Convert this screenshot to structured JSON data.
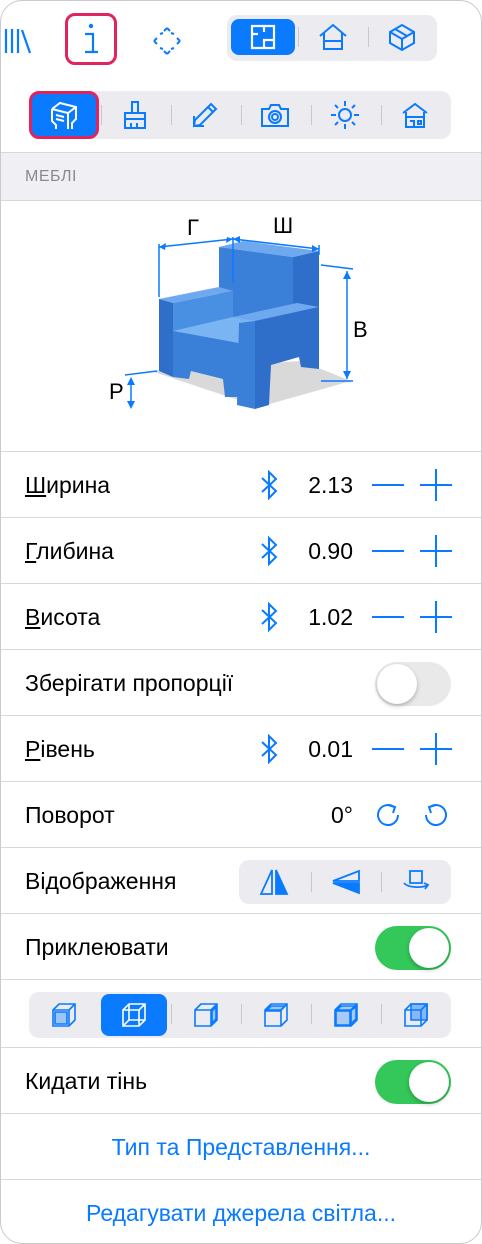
{
  "colors": {
    "accent": "#0a7aff",
    "highlight": "#e0245e",
    "toggle_on": "#34c759",
    "furniture": "#4a90e2"
  },
  "toolbar_top": {
    "buttons": [
      {
        "icon": "library-icon",
        "interactable": true
      },
      {
        "icon": "info-icon",
        "interactable": true,
        "highlighted": true
      },
      {
        "icon": "focus-icon",
        "interactable": true
      }
    ],
    "view_segment": [
      {
        "icon": "floorplan-view-icon",
        "active": true
      },
      {
        "icon": "house-view-icon",
        "active": false
      },
      {
        "icon": "3d-box-view-icon",
        "active": false
      }
    ]
  },
  "toolbar_tools": {
    "items": [
      {
        "icon": "furniture-icon",
        "active": true,
        "highlighted": true
      },
      {
        "icon": "paint-brush-icon",
        "active": false
      },
      {
        "icon": "pencil-icon",
        "active": false
      },
      {
        "icon": "camera-icon",
        "active": false
      },
      {
        "icon": "light-icon",
        "active": false
      },
      {
        "icon": "building-icon",
        "active": false
      }
    ]
  },
  "section": {
    "title": "МЕБЛІ"
  },
  "diagram": {
    "label_depth": "Г",
    "label_width": "Ш",
    "label_height": "В",
    "label_level": "Р"
  },
  "properties": {
    "width": {
      "label_first": "Ш",
      "label_rest": "ирина",
      "value": "2.13"
    },
    "depth": {
      "label_first": "Г",
      "label_rest": "либина",
      "value": "0.90"
    },
    "height": {
      "label_first": "В",
      "label_rest": "исота",
      "value": "1.02"
    },
    "keep_proportions": {
      "label": "Зберігати пропорції",
      "on": false
    },
    "level": {
      "label_first": "Р",
      "label_rest": "івень",
      "value": "0.01"
    },
    "rotation": {
      "label": "Поворот",
      "value": "0°"
    },
    "mirror": {
      "label": "Відображення"
    },
    "snap": {
      "label": "Приклеювати",
      "on": true
    },
    "snap_modes": [
      "cube-front-icon",
      "cube-selected-icon",
      "cube-right-icon",
      "cube-left-icon",
      "cube-top-icon",
      "cube-back-icon"
    ],
    "cast_shadow": {
      "label": "Кидати тінь",
      "on": true
    }
  },
  "links": {
    "type_and_view": "Тип та Представлення...",
    "edit_lights": "Редагувати джерела світла..."
  }
}
